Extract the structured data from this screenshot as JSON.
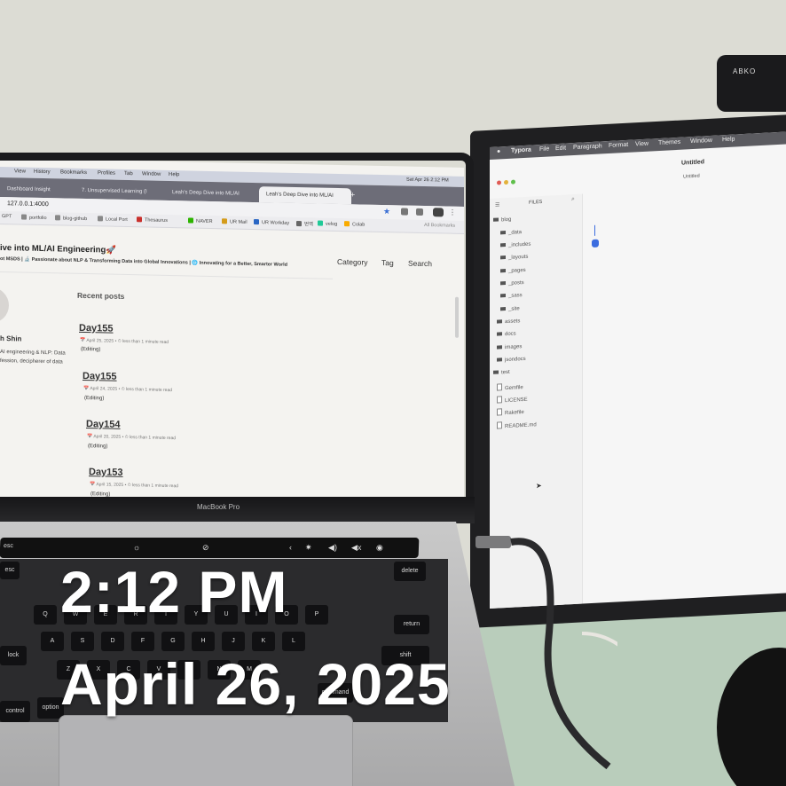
{
  "overlay": {
    "time": "2:12 PM",
    "date": "April 26, 2025"
  },
  "laptop": {
    "brand_label": "MacBook Pro",
    "browser": {
      "menubar": {
        "items": [
          "View",
          "History",
          "Bookmarks",
          "Profiles",
          "Tab",
          "Window",
          "Help"
        ],
        "clock": "Sat Apr 26  2:12 PM"
      },
      "tabs": [
        {
          "label": "Dashboard Insight",
          "active": false
        },
        {
          "label": "7. Unsupervised Learning (I",
          "active": false
        },
        {
          "label": "Leah's Deep Dive into ML/AI",
          "active": false
        },
        {
          "label": "Leah's Deep Dive into ML/AI",
          "active": true
        }
      ],
      "address": "127.0.0.1:4000",
      "bookmarks": [
        "GPT",
        "portfolio",
        "blog-github",
        "Local Port",
        "Thesaurus",
        "NAVER",
        "UR Mail",
        "UR Workday",
        "번역",
        "velog",
        "Colab"
      ],
      "bookmarks_trailing": "All Bookmarks"
    },
    "site": {
      "title": "ive into ML/AI Engineering🚀",
      "subtitle": "ot MSDS | 🔬 Passionate about NLP & Transforming Data into Global Innovations | 🌐 Innovating for a Better, Smarter World",
      "nav": [
        "Category",
        "Tag",
        "Search"
      ],
      "author_name": "h Shin",
      "author_bio": [
        "AI engineering & NLP: Data",
        "fession, decipherer of data"
      ],
      "recent_heading": "Recent posts",
      "posts": [
        {
          "title": "Day155",
          "date": "April 25, 2025",
          "read_time": "less than 1 minute read",
          "status": "(Editing)"
        },
        {
          "title": "Day155",
          "date": "April 24, 2025",
          "read_time": "less than 1 minute read",
          "status": "(Editing)"
        },
        {
          "title": "Day154",
          "date": "April 20, 2025",
          "read_time": "less than 1 minute read",
          "status": "(Editing)"
        },
        {
          "title": "Day153",
          "date": "April 15, 2025",
          "read_time": "less than 1 minute read",
          "status": "(Editing)"
        }
      ]
    },
    "touchbar": {
      "esc": "esc"
    },
    "keyboard": {
      "labels": [
        "esc",
        "Q",
        "W",
        "E",
        "R",
        "T",
        "Y",
        "U",
        "I",
        "O",
        "P",
        "A",
        "S",
        "D",
        "F",
        "G",
        "H",
        "J",
        "K",
        "L",
        "Z",
        "X",
        "C",
        "V",
        "B",
        "N",
        "M",
        "delete",
        "return",
        "shift",
        "lock",
        "control",
        "option",
        "command"
      ]
    }
  },
  "monitor": {
    "webcam_label": "ABKO",
    "menubar": {
      "app": "Typora",
      "items": [
        "File",
        "Edit",
        "Paragraph",
        "Format",
        "View",
        "Themes",
        "Window",
        "Help"
      ]
    },
    "window_title": "Untitled",
    "window_subtitle": "Untitled",
    "files_header": "FILES",
    "tree": [
      {
        "label": "blog",
        "kind": "folder",
        "depth": 0
      },
      {
        "label": "_data",
        "kind": "folder",
        "depth": 1
      },
      {
        "label": "_includes",
        "kind": "folder",
        "depth": 1
      },
      {
        "label": "_layouts",
        "kind": "folder",
        "depth": 1
      },
      {
        "label": "_pages",
        "kind": "folder",
        "depth": 1
      },
      {
        "label": "_posts",
        "kind": "folder",
        "depth": 1
      },
      {
        "label": "_sass",
        "kind": "folder",
        "depth": 1
      },
      {
        "label": "_site",
        "kind": "folder",
        "depth": 1
      },
      {
        "label": "assets",
        "kind": "folder",
        "depth": 1
      },
      {
        "label": "docs",
        "kind": "folder",
        "depth": 1
      },
      {
        "label": "images",
        "kind": "folder",
        "depth": 1
      },
      {
        "label": "jsondocs",
        "kind": "folder",
        "depth": 1
      },
      {
        "label": "test",
        "kind": "folder",
        "depth": 1
      },
      {
        "label": "Gemfile",
        "kind": "file",
        "depth": 1
      },
      {
        "label": "LICENSE",
        "kind": "file",
        "depth": 1
      },
      {
        "label": "Rakefile",
        "kind": "file",
        "depth": 1
      },
      {
        "label": "README.md",
        "kind": "file",
        "depth": 1
      }
    ]
  },
  "colors": {
    "typora_accent": "#3c6ddf",
    "desk": "#b9cdbb",
    "wall": "#dcdcd4"
  }
}
